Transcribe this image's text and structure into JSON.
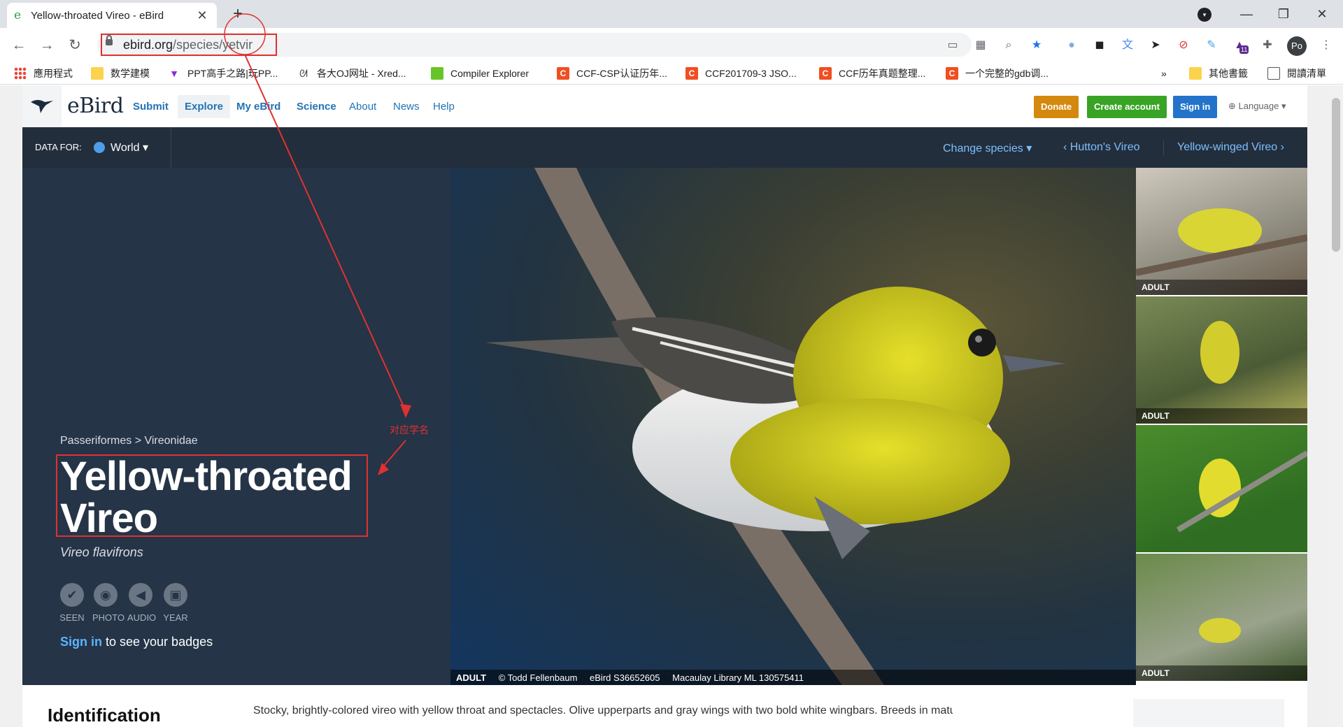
{
  "browser": {
    "tab_title": "Yellow-throated Vireo - eBird",
    "tab_favicon": "e",
    "url_host": "ebird.org",
    "url_path": "/species/yetvir",
    "profile_initials": "Po",
    "extension_badge": "11"
  },
  "bookmarks": [
    {
      "label": "應用程式",
      "icon": "apps-icon"
    },
    {
      "label": "数学建模",
      "icon": "folder-icon"
    },
    {
      "label": "PPT高手之路|玩PP...",
      "icon": "ppt-icon"
    },
    {
      "label": "各大OJ网址 - Xred...",
      "icon": "oj-icon"
    },
    {
      "label": "Compiler Explorer",
      "icon": "compiler-explorer-icon"
    },
    {
      "label": "CCF-CSP认证历年...",
      "icon": "csdn-icon"
    },
    {
      "label": "CCF201709-3 JSO...",
      "icon": "csdn-icon"
    },
    {
      "label": "CCF历年真题整理...",
      "icon": "csdn-icon"
    },
    {
      "label": "一个完整的gdb调...",
      "icon": "csdn-icon"
    }
  ],
  "bookmarks_overflow": "»",
  "bookmarks_right": [
    {
      "label": "其他書籤",
      "icon": "folder-icon"
    },
    {
      "label": "閱讀清單",
      "icon": "reading-list-icon"
    }
  ],
  "site": {
    "logo": "eBird",
    "nav": [
      "Submit",
      "Explore",
      "My eBird",
      "Science",
      "About",
      "News",
      "Help"
    ],
    "buttons": {
      "donate": "Donate",
      "create": "Create account",
      "signin": "Sign in"
    },
    "language": "Language",
    "colors": {
      "donate": "#d4880e",
      "create": "#39a325",
      "signin": "#2273c9",
      "navy": "#253447"
    }
  },
  "databar": {
    "label": "DATA FOR:",
    "region": "World",
    "change_species": "Change species",
    "prev_species": "Hutton's Vireo",
    "next_species": "Yellow-winged Vireo"
  },
  "species": {
    "taxonomy": "Passeriformes > Vireonidae",
    "common_name": "Yellow-throated Vireo",
    "scientific_name": "Vireo flavifrons",
    "badges": [
      "SEEN",
      "PHOTO",
      "AUDIO",
      "YEAR"
    ],
    "signin_link": "Sign in",
    "signin_rest": " to see your badges"
  },
  "photo_caption": {
    "age": "ADULT",
    "credit": "© Todd Fellenbaum",
    "ebird_id": "eBird S36652605",
    "ml_id": "Macaulay Library ML 130575411"
  },
  "thumbnails": [
    "ADULT",
    "ADULT",
    "",
    "ADULT"
  ],
  "identification": {
    "heading": "Identification",
    "text": "Stocky, brightly-colored vireo with yellow throat and spectacles. Olive upperparts and gray wings with two bold white wingbars. Breeds in mature deciduous"
  },
  "annotation": {
    "label": "对应学名"
  }
}
